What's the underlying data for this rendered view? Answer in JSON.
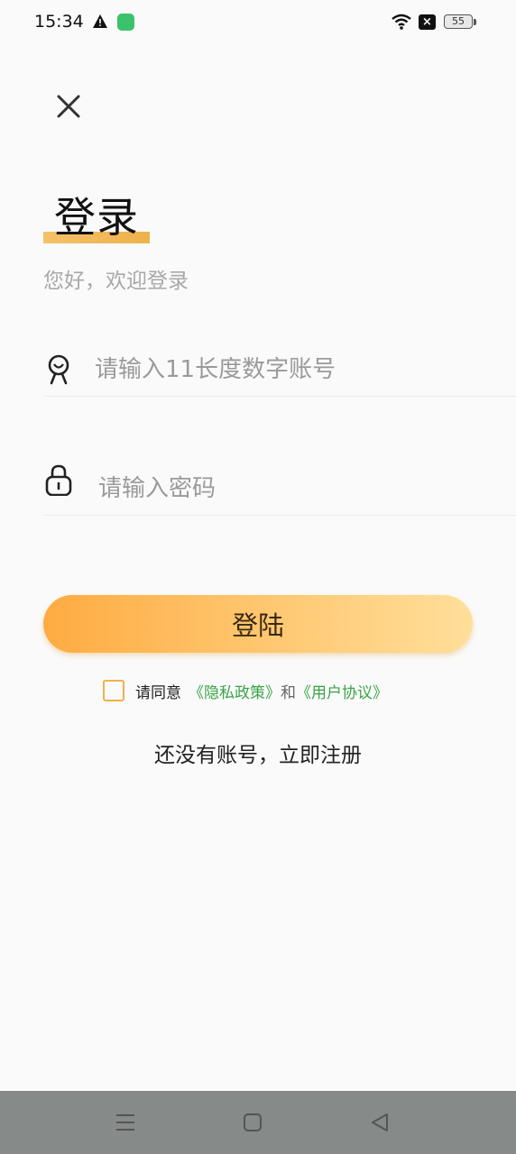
{
  "status_bar": {
    "time": "15:34",
    "battery_level": "55",
    "icons": [
      "warning-icon",
      "app-notification-icon",
      "wifi-icon",
      "no-sim-icon",
      "battery-icon"
    ]
  },
  "login": {
    "close_icon": "close-icon",
    "title": "登录",
    "subtitle": "您好，欢迎登录",
    "account_placeholder": "请输入11长度数字账号",
    "account_icon": "user-icon",
    "password_placeholder": "请输入密码",
    "password_icon": "lock-icon",
    "login_button": "登陆",
    "agreement_prefix": "请同意",
    "privacy_link": "《隐私政策》",
    "agreement_and": "和",
    "user_agreement_link": "《用户协议》",
    "register_link": "还没有账号，立即注册"
  },
  "colors": {
    "accent": "#ffb84f",
    "link": "#39a447",
    "nav_bar": "#868a89"
  },
  "nav_bar": {
    "icons": [
      "menu-icon",
      "home-icon",
      "back-icon"
    ]
  }
}
